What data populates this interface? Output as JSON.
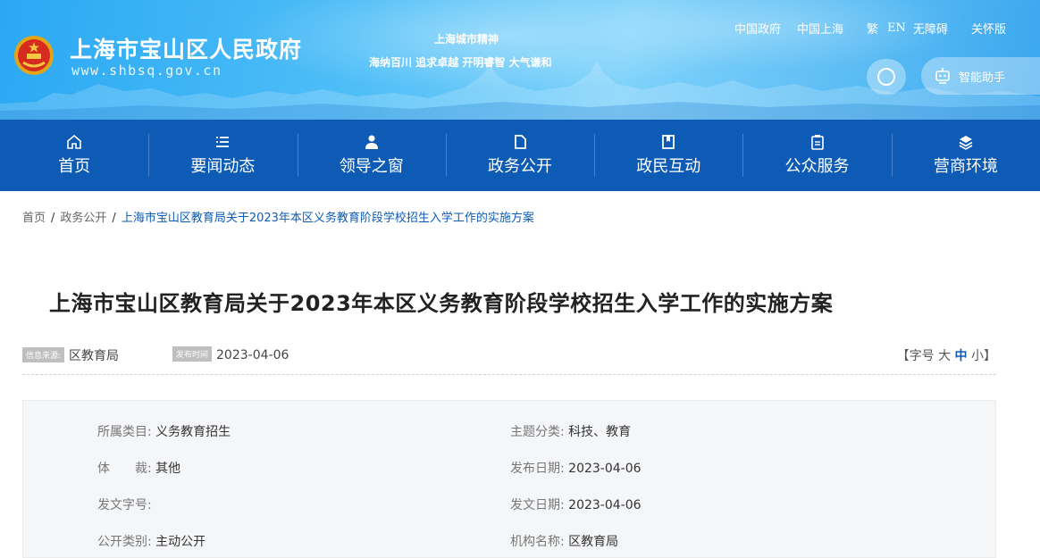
{
  "header": {
    "site_name": "上海市宝山区人民政府",
    "site_url": "www.shbsq.gov.cn",
    "spirit_title": "上海城市精神",
    "spirit_text": "海纳百川 追求卓越 开明睿智 大气谦和",
    "links": [
      "中国政府",
      "中国上海",
      "繁",
      "EN",
      "无障碍",
      "关怀版"
    ],
    "assistant_label": "智能助手",
    "colors": {
      "banner": "#3aa6ee",
      "nav": "#0e5bb6"
    }
  },
  "nav": {
    "items": [
      {
        "label": "首页",
        "icon": "home-icon"
      },
      {
        "label": "要闻动态",
        "icon": "list-icon"
      },
      {
        "label": "领导之窗",
        "icon": "person-icon"
      },
      {
        "label": "政务公开",
        "icon": "document-icon"
      },
      {
        "label": "政民互动",
        "icon": "bookmark-icon"
      },
      {
        "label": "公众服务",
        "icon": "clipboard-icon"
      },
      {
        "label": "营商环境",
        "icon": "layers-icon"
      }
    ]
  },
  "breadcrumb": {
    "items": [
      "首页",
      "政务公开",
      "上海市宝山区教育局关于2023年本区义务教育阶段学校招生入学工作的实施方案"
    ]
  },
  "article": {
    "title": "上海市宝山区教育局关于2023年本区义务教育阶段学校招生入学工作的实施方案",
    "source_tag": "信息来源:",
    "source": "区教育局",
    "date_tag": "发布时间",
    "date": "2023-04-06",
    "fontsize_prefix": "【字号 ",
    "fontsize_large": "大",
    "fontsize_mid": "中",
    "fontsize_small": "小",
    "fontsize_suffix": "】"
  },
  "info": {
    "rows": [
      {
        "l1": "所属类目:",
        "v1": "义务教育招生",
        "l2": "主题分类:",
        "v2": "科技、教育"
      },
      {
        "l1": "体　　裁:",
        "v1": "其他",
        "l2": "发布日期:",
        "v2": "2023-04-06"
      },
      {
        "l1": "发文字号:",
        "v1": "",
        "l2": "发文日期:",
        "v2": "2023-04-06"
      },
      {
        "l1": "公开类别:",
        "v1": "主动公开",
        "l2": "机构名称:",
        "v2": "区教育局"
      }
    ]
  }
}
